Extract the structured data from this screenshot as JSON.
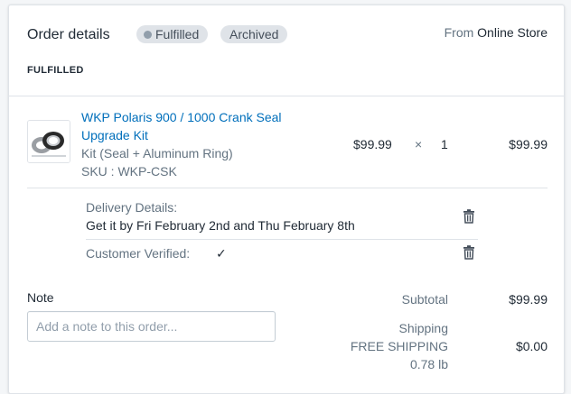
{
  "header": {
    "title": "Order details",
    "badges": [
      {
        "label": "Fulfilled"
      },
      {
        "label": "Archived"
      }
    ],
    "source_prefix": "From",
    "source_name": "Online Store"
  },
  "fulfillment": {
    "status_label": "FULFILLED"
  },
  "line_item": {
    "title": "WKP Polaris 900 / 1000 Crank Seal Upgrade Kit",
    "variant": "Kit (Seal + Aluminum Ring)",
    "sku": "SKU : WKP-CSK",
    "unit_price": "$99.99",
    "times": "×",
    "quantity": "1",
    "total": "$99.99"
  },
  "properties": {
    "delivery_label": "Delivery Details:",
    "delivery_value": "Get it by Fri February 2nd and Thu February 8th",
    "verified_label": "Customer Verified:",
    "verified_value": "✓"
  },
  "note": {
    "label": "Note",
    "placeholder": "Add a note to this order..."
  },
  "summary": {
    "subtotal_label": "Subtotal",
    "subtotal_value": "$99.99",
    "shipping_label": "Shipping",
    "shipping_method": "FREE SHIPPING",
    "shipping_weight": "0.78 lb",
    "shipping_value": "$0.00"
  },
  "colors": {
    "link": "#006fbb",
    "badge_bg": "#dfe3e8",
    "muted_text": "#637381",
    "border": "#dfe3e8"
  },
  "icons": [
    "status-dot-icon",
    "trash-icon",
    "checkmark-icon",
    "product-thumbnail"
  ]
}
